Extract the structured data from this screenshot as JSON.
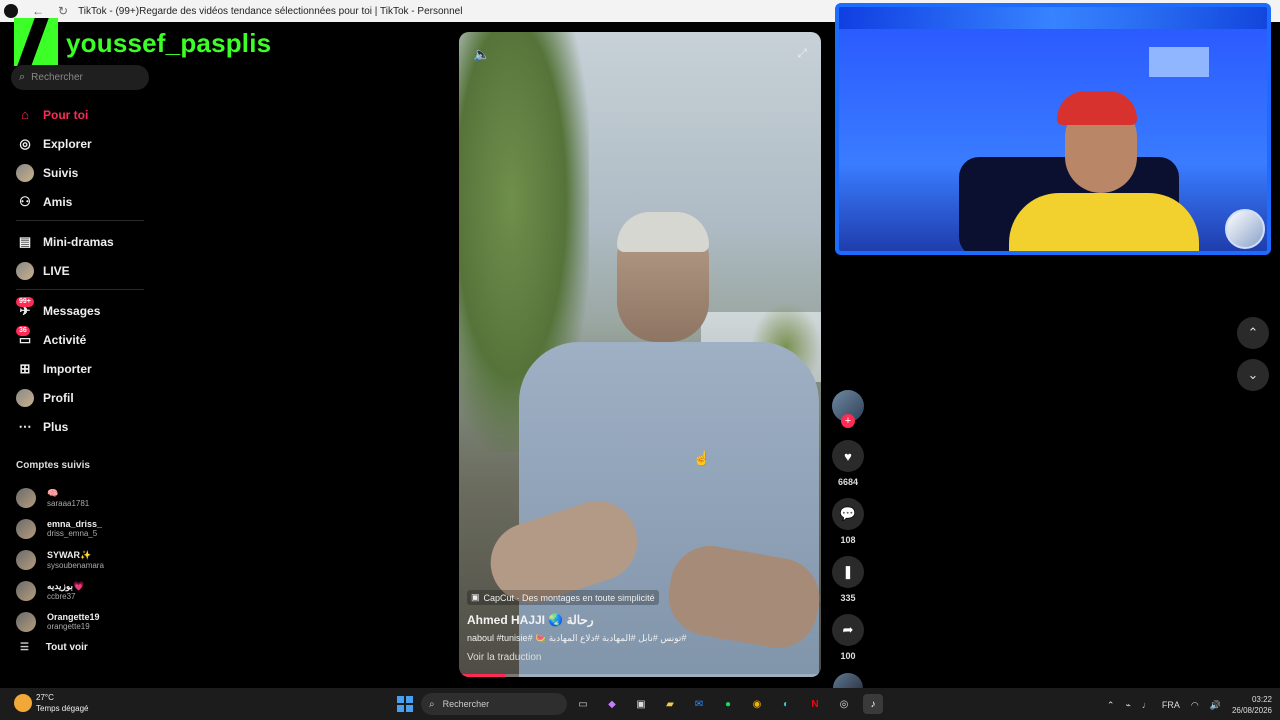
{
  "browser": {
    "title": "TikTok - (99+)Regarde des vidéos tendance sélectionnées pour toi | TikTok - Personnel"
  },
  "overlay": {
    "streamer_name": "youssef_pasplis"
  },
  "sidebar": {
    "search_placeholder": "Rechercher",
    "items": [
      {
        "label": "Pour toi",
        "icon": "home-icon",
        "active": true
      },
      {
        "label": "Explorer",
        "icon": "compass-icon"
      },
      {
        "label": "Suivis",
        "icon": "avatar-icon"
      },
      {
        "label": "Amis",
        "icon": "friends-icon"
      },
      {
        "label": "Mini-dramas",
        "icon": "film-icon"
      },
      {
        "label": "LIVE",
        "icon": "live-avatar-icon"
      },
      {
        "label": "Messages",
        "icon": "message-icon",
        "badge": "99+"
      },
      {
        "label": "Activité",
        "icon": "activity-icon",
        "badge": "36"
      },
      {
        "label": "Importer",
        "icon": "plus-square-icon"
      },
      {
        "label": "Profil",
        "icon": "profile-avatar-icon"
      },
      {
        "label": "Plus",
        "icon": "ellipsis-icon"
      }
    ],
    "followed_title": "Comptes suivis",
    "followed": [
      {
        "name": "🧠",
        "user": "saraaa1781"
      },
      {
        "name": "emna_driss_",
        "user": "driss_emna_5"
      },
      {
        "name": "SYWAR✨",
        "user": "sysoubenamara"
      },
      {
        "name": "بوزيديه💗",
        "user": "ccbre37"
      },
      {
        "name": "Orangette19",
        "user": "orangette19"
      }
    ],
    "see_all": "Tout voir"
  },
  "video": {
    "capcut_text": "CapCut · Des montages en toute simplicité",
    "author": "Ahmed HAJJI 🌏 رحالة",
    "caption": "#تونس #نابل #المهادبة #دلاع المهادبة 🍉 #naboul #tunisie",
    "translate": "Voir la traduction",
    "progress": 0.13
  },
  "actions": {
    "likes": "6684",
    "comments": "108",
    "bookmarks": "335",
    "shares": "100"
  },
  "taskbar": {
    "temperature": "27°C",
    "weather": "Temps dégagé",
    "search_placeholder": "Rechercher",
    "language": "FRA",
    "time": "03:22",
    "date": "26/08/2026"
  }
}
